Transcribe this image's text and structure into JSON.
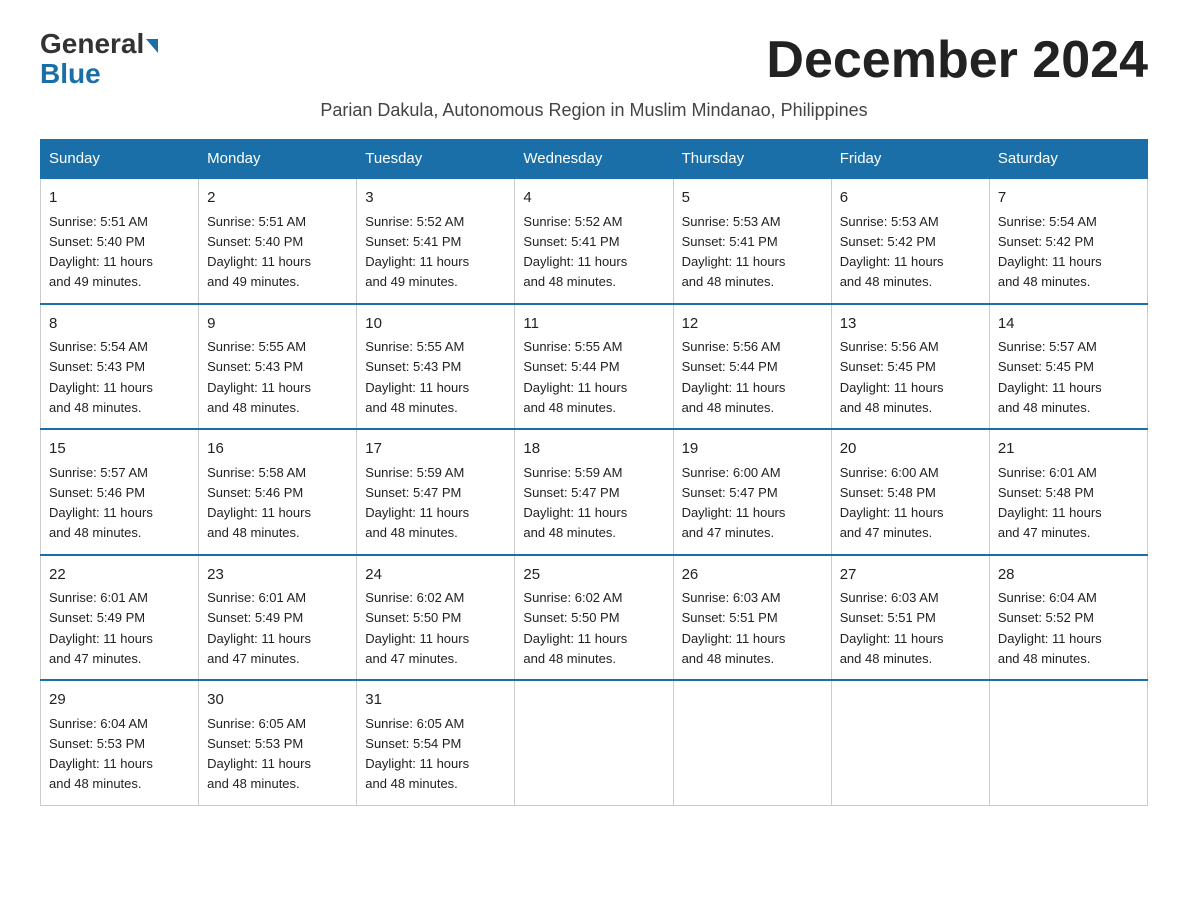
{
  "header": {
    "logo_general": "General",
    "logo_blue": "Blue",
    "title": "December 2024",
    "subtitle": "Parian Dakula, Autonomous Region in Muslim Mindanao, Philippines"
  },
  "days_of_week": [
    "Sunday",
    "Monday",
    "Tuesday",
    "Wednesday",
    "Thursday",
    "Friday",
    "Saturday"
  ],
  "weeks": [
    [
      {
        "day": "1",
        "info": "Sunrise: 5:51 AM\nSunset: 5:40 PM\nDaylight: 11 hours\nand 49 minutes."
      },
      {
        "day": "2",
        "info": "Sunrise: 5:51 AM\nSunset: 5:40 PM\nDaylight: 11 hours\nand 49 minutes."
      },
      {
        "day": "3",
        "info": "Sunrise: 5:52 AM\nSunset: 5:41 PM\nDaylight: 11 hours\nand 49 minutes."
      },
      {
        "day": "4",
        "info": "Sunrise: 5:52 AM\nSunset: 5:41 PM\nDaylight: 11 hours\nand 48 minutes."
      },
      {
        "day": "5",
        "info": "Sunrise: 5:53 AM\nSunset: 5:41 PM\nDaylight: 11 hours\nand 48 minutes."
      },
      {
        "day": "6",
        "info": "Sunrise: 5:53 AM\nSunset: 5:42 PM\nDaylight: 11 hours\nand 48 minutes."
      },
      {
        "day": "7",
        "info": "Sunrise: 5:54 AM\nSunset: 5:42 PM\nDaylight: 11 hours\nand 48 minutes."
      }
    ],
    [
      {
        "day": "8",
        "info": "Sunrise: 5:54 AM\nSunset: 5:43 PM\nDaylight: 11 hours\nand 48 minutes."
      },
      {
        "day": "9",
        "info": "Sunrise: 5:55 AM\nSunset: 5:43 PM\nDaylight: 11 hours\nand 48 minutes."
      },
      {
        "day": "10",
        "info": "Sunrise: 5:55 AM\nSunset: 5:43 PM\nDaylight: 11 hours\nand 48 minutes."
      },
      {
        "day": "11",
        "info": "Sunrise: 5:55 AM\nSunset: 5:44 PM\nDaylight: 11 hours\nand 48 minutes."
      },
      {
        "day": "12",
        "info": "Sunrise: 5:56 AM\nSunset: 5:44 PM\nDaylight: 11 hours\nand 48 minutes."
      },
      {
        "day": "13",
        "info": "Sunrise: 5:56 AM\nSunset: 5:45 PM\nDaylight: 11 hours\nand 48 minutes."
      },
      {
        "day": "14",
        "info": "Sunrise: 5:57 AM\nSunset: 5:45 PM\nDaylight: 11 hours\nand 48 minutes."
      }
    ],
    [
      {
        "day": "15",
        "info": "Sunrise: 5:57 AM\nSunset: 5:46 PM\nDaylight: 11 hours\nand 48 minutes."
      },
      {
        "day": "16",
        "info": "Sunrise: 5:58 AM\nSunset: 5:46 PM\nDaylight: 11 hours\nand 48 minutes."
      },
      {
        "day": "17",
        "info": "Sunrise: 5:59 AM\nSunset: 5:47 PM\nDaylight: 11 hours\nand 48 minutes."
      },
      {
        "day": "18",
        "info": "Sunrise: 5:59 AM\nSunset: 5:47 PM\nDaylight: 11 hours\nand 48 minutes."
      },
      {
        "day": "19",
        "info": "Sunrise: 6:00 AM\nSunset: 5:47 PM\nDaylight: 11 hours\nand 47 minutes."
      },
      {
        "day": "20",
        "info": "Sunrise: 6:00 AM\nSunset: 5:48 PM\nDaylight: 11 hours\nand 47 minutes."
      },
      {
        "day": "21",
        "info": "Sunrise: 6:01 AM\nSunset: 5:48 PM\nDaylight: 11 hours\nand 47 minutes."
      }
    ],
    [
      {
        "day": "22",
        "info": "Sunrise: 6:01 AM\nSunset: 5:49 PM\nDaylight: 11 hours\nand 47 minutes."
      },
      {
        "day": "23",
        "info": "Sunrise: 6:01 AM\nSunset: 5:49 PM\nDaylight: 11 hours\nand 47 minutes."
      },
      {
        "day": "24",
        "info": "Sunrise: 6:02 AM\nSunset: 5:50 PM\nDaylight: 11 hours\nand 47 minutes."
      },
      {
        "day": "25",
        "info": "Sunrise: 6:02 AM\nSunset: 5:50 PM\nDaylight: 11 hours\nand 48 minutes."
      },
      {
        "day": "26",
        "info": "Sunrise: 6:03 AM\nSunset: 5:51 PM\nDaylight: 11 hours\nand 48 minutes."
      },
      {
        "day": "27",
        "info": "Sunrise: 6:03 AM\nSunset: 5:51 PM\nDaylight: 11 hours\nand 48 minutes."
      },
      {
        "day": "28",
        "info": "Sunrise: 6:04 AM\nSunset: 5:52 PM\nDaylight: 11 hours\nand 48 minutes."
      }
    ],
    [
      {
        "day": "29",
        "info": "Sunrise: 6:04 AM\nSunset: 5:53 PM\nDaylight: 11 hours\nand 48 minutes."
      },
      {
        "day": "30",
        "info": "Sunrise: 6:05 AM\nSunset: 5:53 PM\nDaylight: 11 hours\nand 48 minutes."
      },
      {
        "day": "31",
        "info": "Sunrise: 6:05 AM\nSunset: 5:54 PM\nDaylight: 11 hours\nand 48 minutes."
      },
      null,
      null,
      null,
      null
    ]
  ]
}
